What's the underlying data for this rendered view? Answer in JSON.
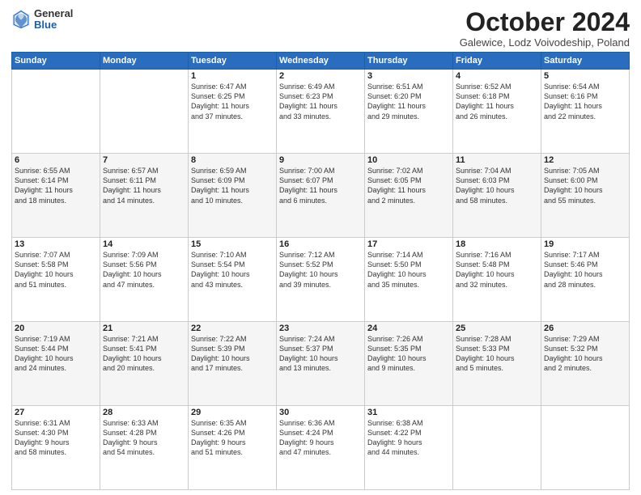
{
  "logo": {
    "general": "General",
    "blue": "Blue"
  },
  "header": {
    "month": "October 2024",
    "location": "Galewice, Lodz Voivodeship, Poland"
  },
  "weekdays": [
    "Sunday",
    "Monday",
    "Tuesday",
    "Wednesday",
    "Thursday",
    "Friday",
    "Saturday"
  ],
  "weeks": [
    [
      {
        "day": "",
        "info": ""
      },
      {
        "day": "",
        "info": ""
      },
      {
        "day": "1",
        "info": "Sunrise: 6:47 AM\nSunset: 6:25 PM\nDaylight: 11 hours\nand 37 minutes."
      },
      {
        "day": "2",
        "info": "Sunrise: 6:49 AM\nSunset: 6:23 PM\nDaylight: 11 hours\nand 33 minutes."
      },
      {
        "day": "3",
        "info": "Sunrise: 6:51 AM\nSunset: 6:20 PM\nDaylight: 11 hours\nand 29 minutes."
      },
      {
        "day": "4",
        "info": "Sunrise: 6:52 AM\nSunset: 6:18 PM\nDaylight: 11 hours\nand 26 minutes."
      },
      {
        "day": "5",
        "info": "Sunrise: 6:54 AM\nSunset: 6:16 PM\nDaylight: 11 hours\nand 22 minutes."
      }
    ],
    [
      {
        "day": "6",
        "info": "Sunrise: 6:55 AM\nSunset: 6:14 PM\nDaylight: 11 hours\nand 18 minutes."
      },
      {
        "day": "7",
        "info": "Sunrise: 6:57 AM\nSunset: 6:11 PM\nDaylight: 11 hours\nand 14 minutes."
      },
      {
        "day": "8",
        "info": "Sunrise: 6:59 AM\nSunset: 6:09 PM\nDaylight: 11 hours\nand 10 minutes."
      },
      {
        "day": "9",
        "info": "Sunrise: 7:00 AM\nSunset: 6:07 PM\nDaylight: 11 hours\nand 6 minutes."
      },
      {
        "day": "10",
        "info": "Sunrise: 7:02 AM\nSunset: 6:05 PM\nDaylight: 11 hours\nand 2 minutes."
      },
      {
        "day": "11",
        "info": "Sunrise: 7:04 AM\nSunset: 6:03 PM\nDaylight: 10 hours\nand 58 minutes."
      },
      {
        "day": "12",
        "info": "Sunrise: 7:05 AM\nSunset: 6:00 PM\nDaylight: 10 hours\nand 55 minutes."
      }
    ],
    [
      {
        "day": "13",
        "info": "Sunrise: 7:07 AM\nSunset: 5:58 PM\nDaylight: 10 hours\nand 51 minutes."
      },
      {
        "day": "14",
        "info": "Sunrise: 7:09 AM\nSunset: 5:56 PM\nDaylight: 10 hours\nand 47 minutes."
      },
      {
        "day": "15",
        "info": "Sunrise: 7:10 AM\nSunset: 5:54 PM\nDaylight: 10 hours\nand 43 minutes."
      },
      {
        "day": "16",
        "info": "Sunrise: 7:12 AM\nSunset: 5:52 PM\nDaylight: 10 hours\nand 39 minutes."
      },
      {
        "day": "17",
        "info": "Sunrise: 7:14 AM\nSunset: 5:50 PM\nDaylight: 10 hours\nand 35 minutes."
      },
      {
        "day": "18",
        "info": "Sunrise: 7:16 AM\nSunset: 5:48 PM\nDaylight: 10 hours\nand 32 minutes."
      },
      {
        "day": "19",
        "info": "Sunrise: 7:17 AM\nSunset: 5:46 PM\nDaylight: 10 hours\nand 28 minutes."
      }
    ],
    [
      {
        "day": "20",
        "info": "Sunrise: 7:19 AM\nSunset: 5:44 PM\nDaylight: 10 hours\nand 24 minutes."
      },
      {
        "day": "21",
        "info": "Sunrise: 7:21 AM\nSunset: 5:41 PM\nDaylight: 10 hours\nand 20 minutes."
      },
      {
        "day": "22",
        "info": "Sunrise: 7:22 AM\nSunset: 5:39 PM\nDaylight: 10 hours\nand 17 minutes."
      },
      {
        "day": "23",
        "info": "Sunrise: 7:24 AM\nSunset: 5:37 PM\nDaylight: 10 hours\nand 13 minutes."
      },
      {
        "day": "24",
        "info": "Sunrise: 7:26 AM\nSunset: 5:35 PM\nDaylight: 10 hours\nand 9 minutes."
      },
      {
        "day": "25",
        "info": "Sunrise: 7:28 AM\nSunset: 5:33 PM\nDaylight: 10 hours\nand 5 minutes."
      },
      {
        "day": "26",
        "info": "Sunrise: 7:29 AM\nSunset: 5:32 PM\nDaylight: 10 hours\nand 2 minutes."
      }
    ],
    [
      {
        "day": "27",
        "info": "Sunrise: 6:31 AM\nSunset: 4:30 PM\nDaylight: 9 hours\nand 58 minutes."
      },
      {
        "day": "28",
        "info": "Sunrise: 6:33 AM\nSunset: 4:28 PM\nDaylight: 9 hours\nand 54 minutes."
      },
      {
        "day": "29",
        "info": "Sunrise: 6:35 AM\nSunset: 4:26 PM\nDaylight: 9 hours\nand 51 minutes."
      },
      {
        "day": "30",
        "info": "Sunrise: 6:36 AM\nSunset: 4:24 PM\nDaylight: 9 hours\nand 47 minutes."
      },
      {
        "day": "31",
        "info": "Sunrise: 6:38 AM\nSunset: 4:22 PM\nDaylight: 9 hours\nand 44 minutes."
      },
      {
        "day": "",
        "info": ""
      },
      {
        "day": "",
        "info": ""
      }
    ]
  ],
  "colors": {
    "header_bg": "#2a6dbf",
    "header_text": "#ffffff",
    "accent": "#1a5fa8"
  }
}
